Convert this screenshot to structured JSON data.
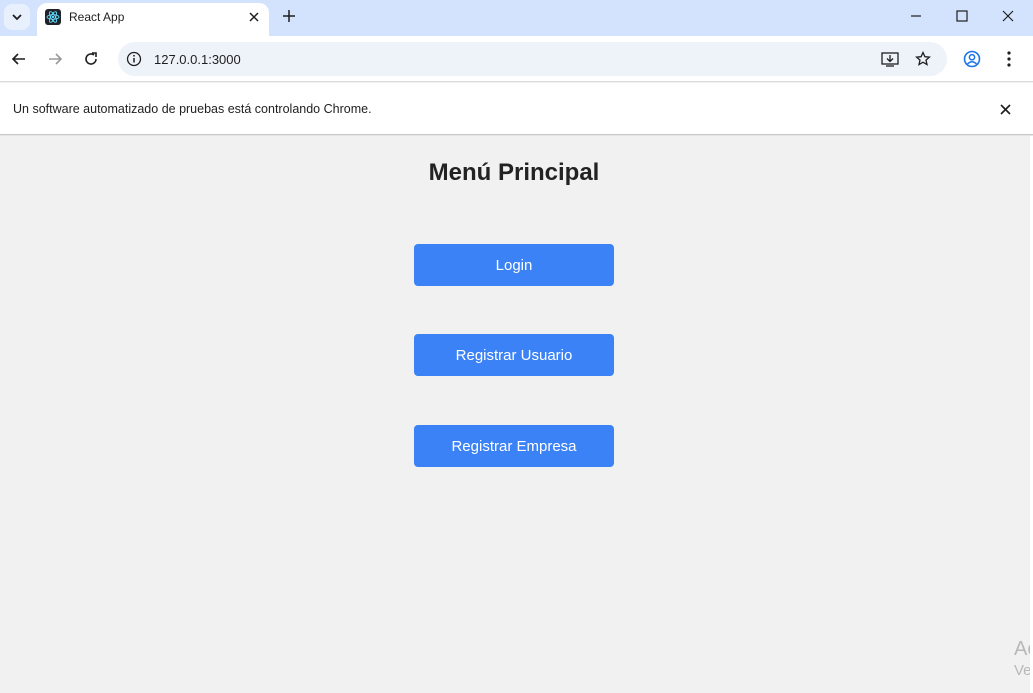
{
  "browser": {
    "tab_title": "React App",
    "url": "127.0.0.1:3000"
  },
  "infobar": {
    "message": "Un software automatizado de pruebas está controlando Chrome."
  },
  "page": {
    "title": "Menú Principal",
    "buttons": [
      {
        "label": "Login"
      },
      {
        "label": "Registrar Usuario"
      },
      {
        "label": "Registrar Empresa"
      }
    ],
    "button_color": "#3b82f6"
  },
  "watermark": {
    "line1": "Ac",
    "line2": "Ve"
  }
}
